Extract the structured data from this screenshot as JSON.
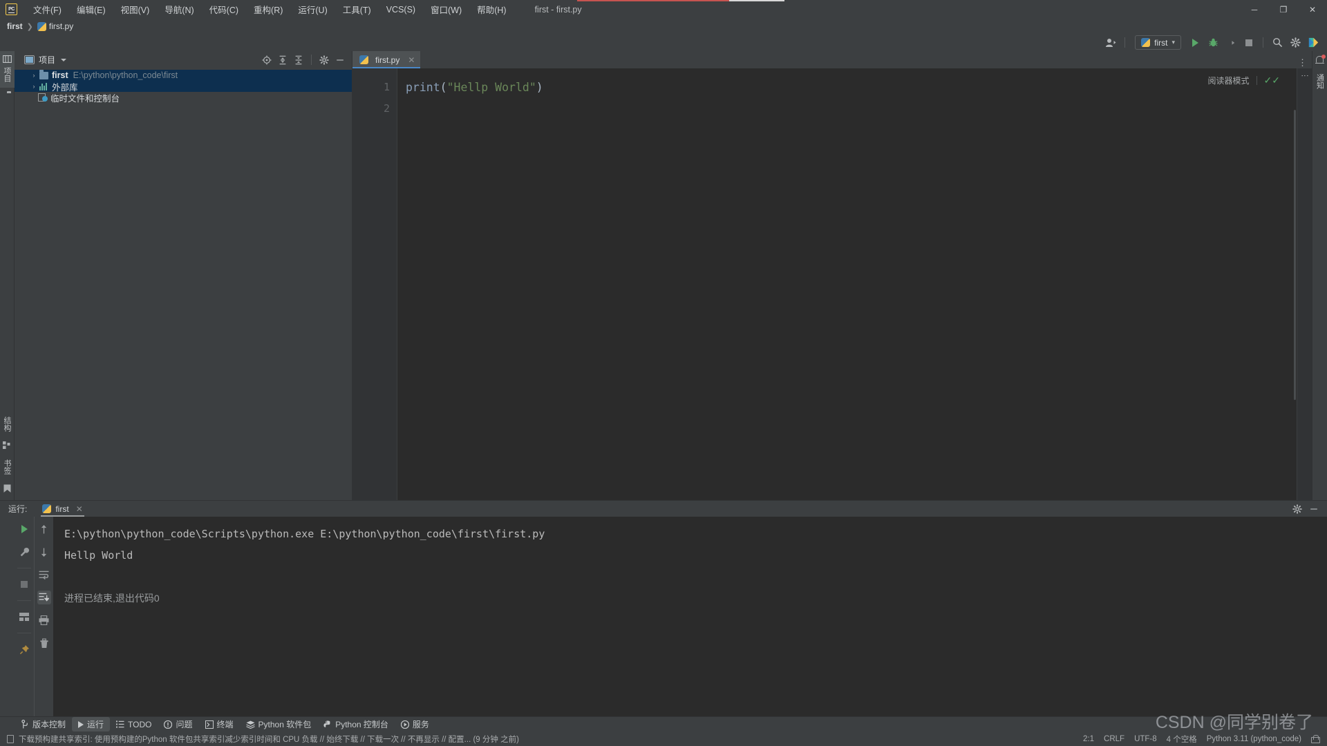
{
  "window": {
    "title": "first - first.py",
    "minimize": "─",
    "maximize": "❐",
    "close": "✕"
  },
  "menu": {
    "items": [
      {
        "label": "文件(F)"
      },
      {
        "label": "编辑(E)"
      },
      {
        "label": "视图(V)"
      },
      {
        "label": "导航(N)"
      },
      {
        "label": "代码(C)"
      },
      {
        "label": "重构(R)"
      },
      {
        "label": "运行(U)"
      },
      {
        "label": "工具(T)"
      },
      {
        "label": "VCS(S)"
      },
      {
        "label": "窗口(W)"
      },
      {
        "label": "帮助(H)"
      }
    ]
  },
  "breadcrumb": {
    "project": "first",
    "separator": "❯",
    "file": "first.py"
  },
  "toolbar": {
    "run_config": "first",
    "config_caret": "▾",
    "account_caret": "▾"
  },
  "project_panel": {
    "title": "项目",
    "rail_label": "项目",
    "tree": [
      {
        "name": "first",
        "path": "E:\\python\\python_code\\first",
        "arrow": "›",
        "icon": "folder-icon",
        "selected": true
      },
      {
        "name": "外部库",
        "path": "",
        "arrow": "›",
        "icon": "library-icon",
        "selected": true
      },
      {
        "name": "临时文件和控制台",
        "path": "",
        "arrow": "",
        "icon": "scratch-icon",
        "selected": false
      }
    ]
  },
  "editor": {
    "tab_label": "first.py",
    "tab_close": "✕",
    "reader_mode": "阅读器模式",
    "line_numbers": [
      "1",
      "2"
    ],
    "code": {
      "fn": "print",
      "open_paren": "(",
      "string": "\"Hellp World\"",
      "close_paren": ")"
    }
  },
  "run_window": {
    "label": "运行:",
    "tab_name": "first",
    "tab_close": "✕",
    "rail_label": "运行",
    "console_lines": [
      "E:\\python\\python_code\\Scripts\\python.exe E:\\python\\python_code\\first\\first.py",
      "Hellp World"
    ],
    "exit_line": "进程已结束,退出代码0"
  },
  "left_rail": {
    "structure": "结构",
    "bookmarks": "书签"
  },
  "bottom_bar": {
    "items": [
      {
        "label": "版本控制",
        "icon": "branch-icon",
        "active": false
      },
      {
        "label": "运行",
        "icon": "play-icon",
        "active": true
      },
      {
        "label": "TODO",
        "icon": "list-icon",
        "active": false
      },
      {
        "label": "问题",
        "icon": "warning-icon",
        "active": false
      },
      {
        "label": "终端",
        "icon": "terminal-icon",
        "active": false
      },
      {
        "label": "Python 软件包",
        "icon": "packages-icon",
        "active": false
      },
      {
        "label": "Python 控制台",
        "icon": "python-console-icon",
        "active": false
      },
      {
        "label": "服务",
        "icon": "services-icon",
        "active": false
      }
    ]
  },
  "status_bar": {
    "message": "下载预构建共享索引: 使用预构建的Python 软件包共享索引减少索引时间和 CPU 负载 // 始终下载 // 下载一次 // 不再显示 // 配置... (9 分钟 之前)",
    "caret_position": "2:1",
    "line_separator": "CRLF",
    "encoding": "UTF-8",
    "indent": "4 个空格",
    "interpreter": "Python 3.11 (python_code)"
  },
  "watermark": "CSDN @同学别卷了",
  "colors": {
    "chrome": "#3c3f41",
    "editor_bg": "#2b2b2b",
    "gutter_bg": "#313335",
    "selection": "#0d2f4f",
    "accent_tab": "#4a88c7",
    "run_green": "#59a869",
    "string_green": "#6a8759",
    "function_blue": "#8a9fb8",
    "path_gray": "#7d8a93",
    "top_accent": "#c75450"
  }
}
